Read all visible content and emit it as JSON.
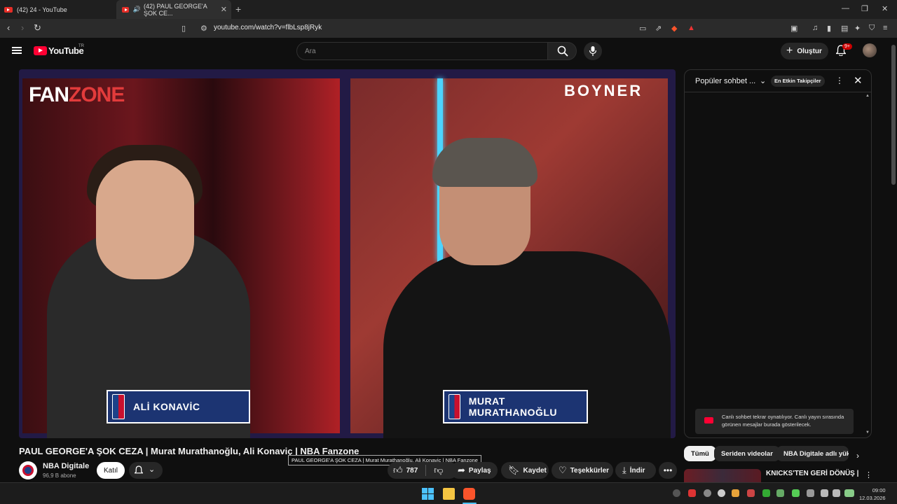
{
  "browser": {
    "tabs": [
      {
        "label": "(42) 24 - YouTube"
      },
      {
        "label": "(42) PAUL GEORGE'A ŞOK CE..."
      }
    ],
    "url": "youtube.com/watch?v=flbLsp8jRyk"
  },
  "masthead": {
    "logo": "YouTube",
    "region": "TR",
    "search_placeholder": "Ara",
    "create_label": "Oluştur",
    "notif_count": "9+"
  },
  "player": {
    "brand_left_a": "FAN",
    "brand_left_b": "ZONE",
    "brand_right": "BOYNER",
    "lower_third_1": "ALİ KONAVİC",
    "lower_third_2": "MURAT MURATHANOĞLU"
  },
  "video": {
    "title": "PAUL GEORGE'A ŞOK CEZA | Murat Murathanoğlu, Ali Konaviç | NBA Fanzone",
    "tooltip": "PAUL GEORGE'A ŞOK CEZA | Murat Murathanoğlu, Ali Konaviç | NBA Fanzone",
    "channel": "NBA Digitale",
    "subscribers": "96,9 B abone",
    "join_label": "Katıl",
    "like_count": "787",
    "share_label": "Paylaş",
    "save_label": "Kaydet",
    "thanks_label": "Teşekkürler",
    "download_label": "İndir"
  },
  "chat": {
    "title": "Popüler sohbet ...",
    "badge": "En Etkin Takipçiler",
    "notice": "Canlı sohbet tekrar oynatılıyor. Canlı yayın sırasında görünen mesajlar burada gösterilecek."
  },
  "chips": [
    "Tümü",
    "Seriden videolar",
    "NBA Digitale adlı yük"
  ],
  "recommendation": {
    "title": "KNICKS'TEN GERİ DÖNÜŞ |"
  },
  "taskbar": {
    "time": "09:00",
    "date": "12.03.2026"
  },
  "colors": {
    "youtube_red": "#ff0033",
    "nba_blue": "#1d428a",
    "nba_red": "#c8102e"
  }
}
